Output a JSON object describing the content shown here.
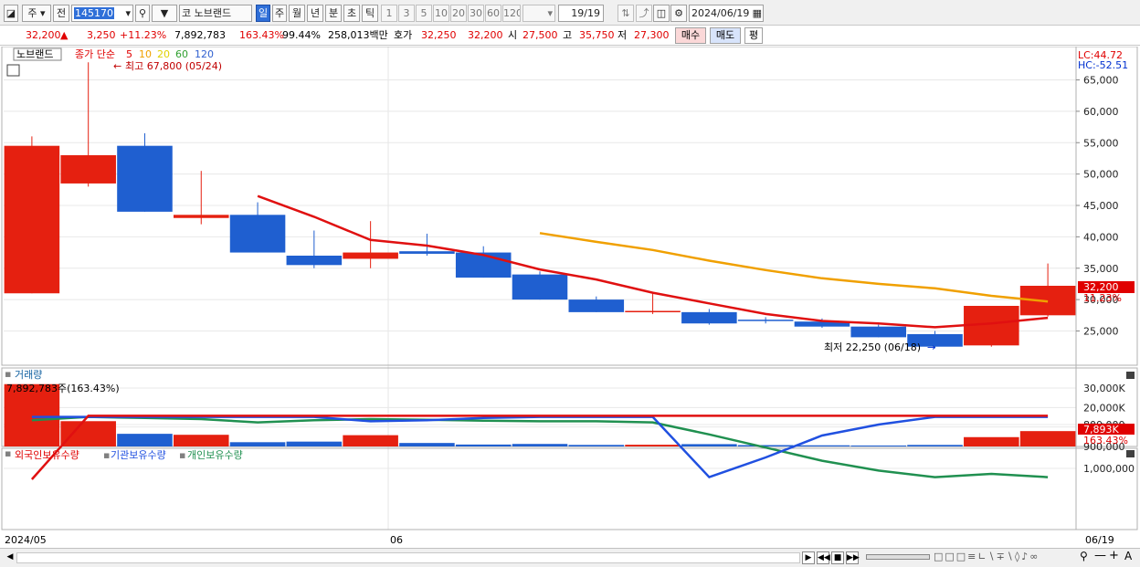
{
  "toolbar": {
    "week": "주",
    "prev": "전",
    "code": "145170",
    "market": "코",
    "name": "노브랜드",
    "periods": [
      "일",
      "주",
      "월",
      "년",
      "분",
      "초",
      "틱"
    ],
    "numbers": [
      "1",
      "3",
      "5",
      "10",
      "20",
      "30",
      "60",
      "120"
    ],
    "page": "19/19",
    "date": "2024/06/19"
  },
  "quote": {
    "price": "32,200",
    "change": "3,250",
    "change_pct": "+11.23%",
    "volume": "7,892,783",
    "vol_ratio": "163.43%",
    "ratio2": "99.44%",
    "amount": "258,013백만",
    "ask_label": "호가",
    "ask1": "32,250",
    "ask2": "32,200",
    "open_label": "시",
    "open": "27,500",
    "high_label": "고",
    "high": "35,750",
    "low_label": "저",
    "low": "27,300",
    "buy": "매수",
    "sell": "매도",
    "avg": "평"
  },
  "price_chart": {
    "stock_label": "노브랜드",
    "ma_title": "종가 단순",
    "ma_periods": [
      "5",
      "10",
      "20",
      "60",
      "120"
    ],
    "ma_colors": [
      "#e00000",
      "#f0a000",
      "#f0d000",
      "#30a030",
      "#3060d0"
    ],
    "high_note": "최고 67,800 (05/24)",
    "low_note": "최저 22,250 (06/18)",
    "lc": "LC:44.72",
    "hc": "HC:-52.51",
    "cur_price": "32,200",
    "cur_pct": "11.23%",
    "yticks": [
      "65,000",
      "60,000",
      "55,000",
      "50,000",
      "45,000",
      "40,000",
      "35,000",
      "30,000",
      "25,000"
    ]
  },
  "volume_chart": {
    "title": "거래량",
    "note": "7,892,783주(163.43%)",
    "yticks": [
      "30,000K",
      "20,000K",
      "10,000K"
    ],
    "cur": "7,893K",
    "cur_pct": "163.43%"
  },
  "holding_chart": {
    "legend": [
      "외국인보유수량",
      "기관보유수량",
      "개인보유수량"
    ],
    "colors": [
      "#e00000",
      "#2050e0",
      "#209050"
    ],
    "yticks": [
      "1,000,000",
      "900,000",
      "800,000"
    ]
  },
  "dates": {
    "start": "2024/05",
    "mid": "06",
    "end": "06/19"
  },
  "chart_data": {
    "type": "candlestick",
    "candles": [
      {
        "o": 54500,
        "h": 56000,
        "l": 31000,
        "c": 31000,
        "up": true
      },
      {
        "o": 48500,
        "h": 67800,
        "l": 48000,
        "c": 53000,
        "up": true
      },
      {
        "o": 54500,
        "h": 56500,
        "l": 44000,
        "c": 44000,
        "up": false
      },
      {
        "o": 43500,
        "h": 50500,
        "l": 42000,
        "c": 43000,
        "up": true
      },
      {
        "o": 43500,
        "h": 45500,
        "l": 37500,
        "c": 37500,
        "up": false
      },
      {
        "o": 37000,
        "h": 41000,
        "l": 35000,
        "c": 35500,
        "up": false
      },
      {
        "o": 36500,
        "h": 42500,
        "l": 35000,
        "c": 37500,
        "up": true
      },
      {
        "o": 37700,
        "h": 40500,
        "l": 37000,
        "c": 37300,
        "up": false
      },
      {
        "o": 37500,
        "h": 38500,
        "l": 33500,
        "c": 33500,
        "up": false
      },
      {
        "o": 34000,
        "h": 34500,
        "l": 30000,
        "c": 30000,
        "up": false
      },
      {
        "o": 30000,
        "h": 30500,
        "l": 28000,
        "c": 28000,
        "up": false
      },
      {
        "o": 28000,
        "h": 31000,
        "l": 27700,
        "c": 28200,
        "up": true
      },
      {
        "o": 28000,
        "h": 28500,
        "l": 26000,
        "c": 26200,
        "up": false
      },
      {
        "o": 26800,
        "h": 27200,
        "l": 26200,
        "c": 26700,
        "up": false
      },
      {
        "o": 26500,
        "h": 27000,
        "l": 25500,
        "c": 25700,
        "up": false
      },
      {
        "o": 25700,
        "h": 26000,
        "l": 24000,
        "c": 24000,
        "up": false
      },
      {
        "o": 24500,
        "h": 25000,
        "l": 22250,
        "c": 22500,
        "up": false
      },
      {
        "o": 22700,
        "h": 29000,
        "l": 22500,
        "c": 29000,
        "up": true
      },
      {
        "o": 27500,
        "h": 35750,
        "l": 27300,
        "c": 32200,
        "up": true
      }
    ],
    "ma5": [
      null,
      null,
      null,
      null,
      46500,
      43200,
      39500,
      38600,
      37100,
      34800,
      33200,
      31100,
      29400,
      27700,
      26600,
      26200,
      25600,
      26200,
      27100
    ],
    "ma10": [
      null,
      null,
      null,
      null,
      null,
      null,
      null,
      null,
      null,
      40600,
      39200,
      37900,
      36200,
      34700,
      33400,
      32500,
      31800,
      30600,
      29700
    ],
    "volume": [
      32000,
      13000,
      6500,
      6000,
      2200,
      2500,
      5800,
      1800,
      1000,
      1300,
      800,
      900,
      1200,
      700,
      600,
      500,
      800,
      4800,
      7893
    ],
    "foreign": [
      1050000,
      760000,
      760000,
      760000,
      760000,
      760000,
      760000,
      760000,
      760000,
      760000,
      760000,
      760000,
      760000,
      760000,
      760000,
      760000,
      760000,
      760000,
      760000
    ],
    "institution": [
      765000,
      765000,
      765000,
      765000,
      765000,
      765000,
      785000,
      780000,
      770000,
      765000,
      765000,
      765000,
      1040000,
      950000,
      850000,
      800000,
      765000,
      765000,
      765000
    ],
    "individual": [
      780000,
      765000,
      770000,
      775000,
      790000,
      780000,
      775000,
      778000,
      782000,
      785000,
      785000,
      790000,
      845000,
      905000,
      965000,
      1010000,
      1040000,
      1025000,
      1040000
    ]
  }
}
